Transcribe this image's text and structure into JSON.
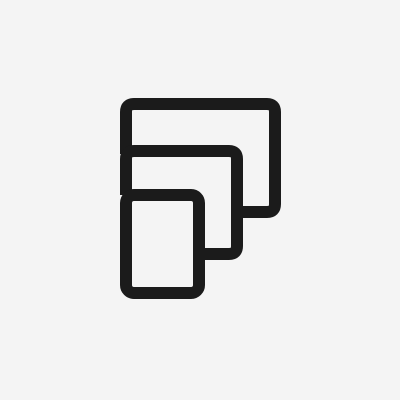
{
  "icon": {
    "name": "nested-rectangles-icon",
    "stroke_color": "#1b1b1b",
    "background_color": "#f4f4f4"
  }
}
